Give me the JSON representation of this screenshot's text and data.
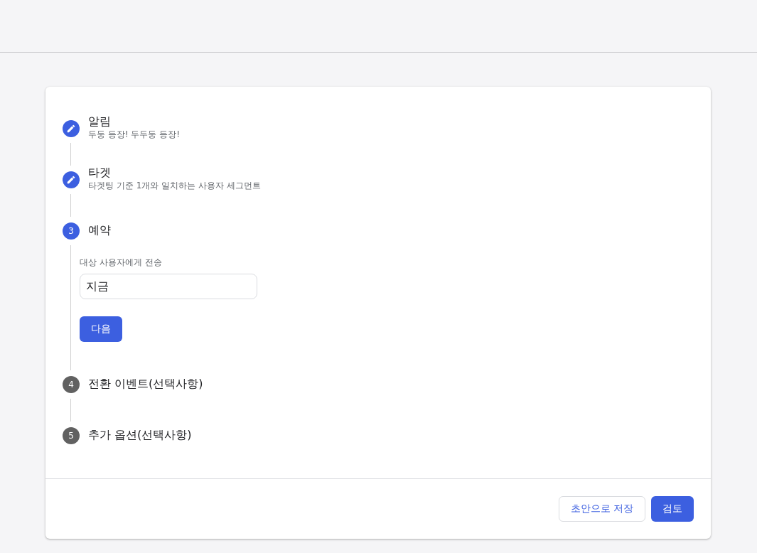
{
  "steps": [
    {
      "kind": "edited",
      "title": "알림",
      "subtitle": "두둥 등장! 두두둥 등장!"
    },
    {
      "kind": "edited",
      "title": "타겟",
      "subtitle": "타겟팅 기준 1개와 일치하는 사용자 세그먼트"
    },
    {
      "kind": "current",
      "number": "3",
      "title": "예약",
      "form": {
        "label": "대상 사용자에게 전송",
        "value": "지금",
        "button": "다음"
      }
    },
    {
      "kind": "upcoming",
      "number": "4",
      "title": "전환 이벤트(선택사항)"
    },
    {
      "kind": "upcoming",
      "number": "5",
      "title": "추가 옵션(선택사항)"
    }
  ],
  "footer": {
    "buttons": [
      {
        "kind": "outlined",
        "label": "초안으로 저장"
      },
      {
        "kind": "filled",
        "label": "검토"
      }
    ]
  }
}
